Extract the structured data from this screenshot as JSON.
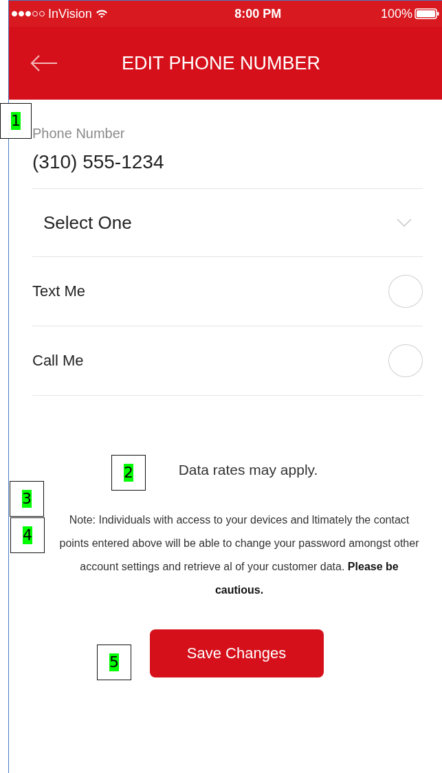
{
  "status_bar": {
    "carrier": "InVision",
    "time": "8:00 PM",
    "battery": "100%"
  },
  "header": {
    "title": "EDIT PHONE NUMBER"
  },
  "phone_field": {
    "label": "Phone Number",
    "value": "(310) 555-1234"
  },
  "type_select": {
    "placeholder": "Select One"
  },
  "options": [
    {
      "label": "Text Me",
      "checked": false
    },
    {
      "label": "Call Me",
      "checked": false
    }
  ],
  "data_rates": "Data rates may apply.",
  "note": "Note: Individuals with access to your devices and ltimately the contact points entered above will be able to change your password amongst other account settings and retrieve al of your customer data. **Please be cautious.**",
  "save_button": "Save Changes",
  "annotations": [
    "1",
    "2",
    "3",
    "4",
    "5"
  ]
}
